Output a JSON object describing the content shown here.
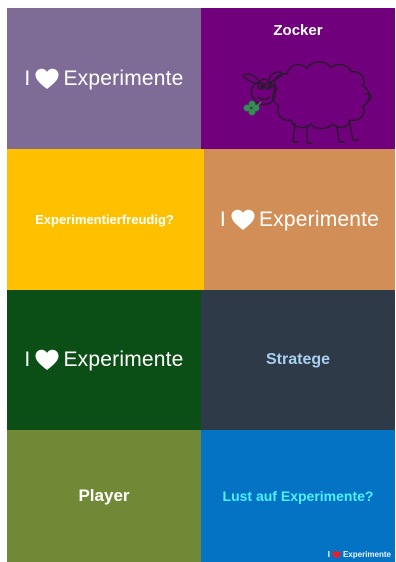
{
  "tiles": [
    {
      "id": "tile-1",
      "color": "#7e6c97",
      "text_i": "I",
      "text_word": "Experimente",
      "icon": "heart-icon"
    },
    {
      "id": "tile-2",
      "color": "#70007c",
      "title": "Zocker",
      "icon": "sheep-illustration"
    },
    {
      "id": "tile-3",
      "color": "#ffc000",
      "label": "Experimentierfreudig?"
    },
    {
      "id": "tile-4",
      "color": "#d28e57",
      "text_i": "I",
      "text_word": "Experimente",
      "icon": "heart-icon"
    },
    {
      "id": "tile-5",
      "color": "#0b4e16",
      "text_i": "I",
      "text_word": "Experimente",
      "icon": "heart-icon"
    },
    {
      "id": "tile-6",
      "color": "#2e3a48",
      "label": "Stratege",
      "label_color": "#a8cfee"
    },
    {
      "id": "tile-7",
      "color": "#718936",
      "label": "Player"
    },
    {
      "id": "tile-8",
      "color": "#0573c4",
      "label": "Lust auf Experimente?",
      "label_color": "#4ef0ff",
      "mini": {
        "text_i": "I",
        "text_word": "Experimente",
        "heart_color": "#e81e2b"
      }
    }
  ]
}
